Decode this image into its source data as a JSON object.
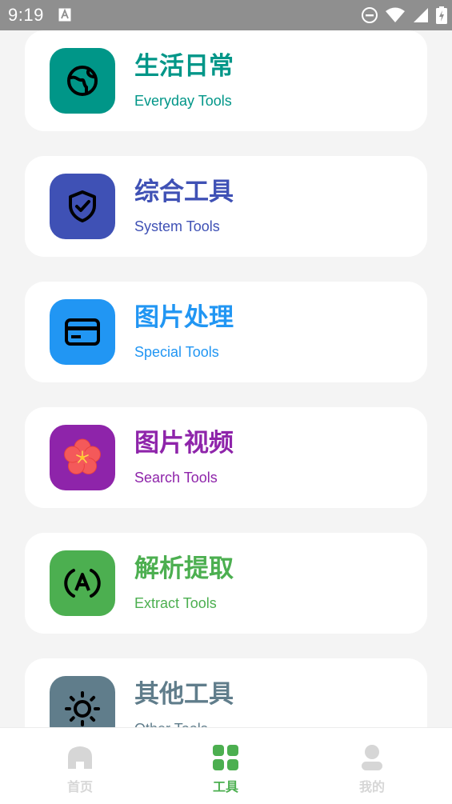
{
  "status_bar": {
    "time": "9:19",
    "icons": [
      "a-notification-icon",
      "do-not-disturb-icon",
      "wifi-icon",
      "battery-charging-icon"
    ]
  },
  "tool_categories": [
    {
      "title": "生活日常",
      "subtitle": "Everyday Tools",
      "color": "#009688",
      "icon": "earth-icon"
    },
    {
      "title": "综合工具",
      "subtitle": "System Tools",
      "color": "#3f51b5",
      "icon": "shield-check-icon"
    },
    {
      "title": "图片处理",
      "subtitle": "Special Tools",
      "color": "#2196f3",
      "icon": "card-icon"
    },
    {
      "title": "图片视频",
      "subtitle": "Search Tools",
      "color": "#8e24aa",
      "icon": "flower-icon"
    },
    {
      "title": "解析提取",
      "subtitle": "Extract Tools",
      "color": "#4caf50",
      "icon": "text-recognition-icon"
    },
    {
      "title": "其他工具",
      "subtitle": "Other Tools",
      "color": "#607d8b",
      "icon": "sun-icon"
    }
  ],
  "bottom_nav": {
    "items": [
      {
        "label": "首页",
        "icon": "home-icon",
        "active": false
      },
      {
        "label": "工具",
        "icon": "grid-icon",
        "active": true
      },
      {
        "label": "我的",
        "icon": "user-icon",
        "active": false
      }
    ],
    "active_color": "#4caf50",
    "inactive_color": "#d6d6d6"
  }
}
